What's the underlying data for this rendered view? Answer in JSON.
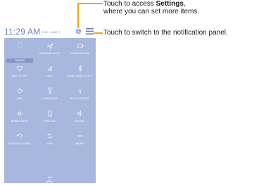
{
  "status_bar": {
    "time": "11:29 AM",
    "date": "TUE, JUNE 3"
  },
  "tiles": [
    {
      "name": "owner",
      "label": "OWNER",
      "icon": "user-icon"
    },
    {
      "name": "airplane-mode",
      "label": "AIRPLANE MODE",
      "icon": "airplane-icon"
    },
    {
      "name": "charging",
      "label": "CHARGING 98%",
      "icon": "battery-icon"
    },
    {
      "name": "wifi",
      "label": "WI-FI IS OFF",
      "icon": "wifi-icon"
    },
    {
      "name": "cell",
      "label": "DELL",
      "icon": "signal-icon"
    },
    {
      "name": "bluetooth",
      "label": "BLUETOOTH IS OFF",
      "icon": "bluetooth-icon"
    },
    {
      "name": "gps",
      "label": "GPS",
      "icon": "location-icon"
    },
    {
      "name": "flashlight",
      "label": "FLASHLIGHT",
      "icon": "flashlight-icon"
    },
    {
      "name": "wifi-hotspot",
      "label": "WI-FI HOTSPOT",
      "icon": "hotspot-icon"
    },
    {
      "name": "brightness",
      "label": "BRIGHTNESS",
      "icon": "brightness-icon"
    },
    {
      "name": "time-out",
      "label": "TIME OUT",
      "icon": "timeout-icon"
    },
    {
      "name": "sound",
      "label": "SOUND",
      "icon": "speaker-icon"
    },
    {
      "name": "rotation-locked",
      "label": "ROTATION LOCKED",
      "icon": "rotation-icon"
    },
    {
      "name": "sync",
      "label": "SYNC",
      "icon": "sync-icon"
    },
    {
      "name": "more",
      "label": "MORE",
      "icon": "more-icon"
    }
  ],
  "bottom": {
    "brightness_value": "9x0"
  },
  "callouts": {
    "settings_prefix": "Touch to access ",
    "settings_bold": "Settings",
    "settings_suffix": ",",
    "settings_line2": "where you can set more items.",
    "notification": "Touch to switch to the notification panel."
  },
  "colors": {
    "panel": "#a7b7dd",
    "accent": "#f5a300",
    "clock": "#6b7fc0"
  }
}
